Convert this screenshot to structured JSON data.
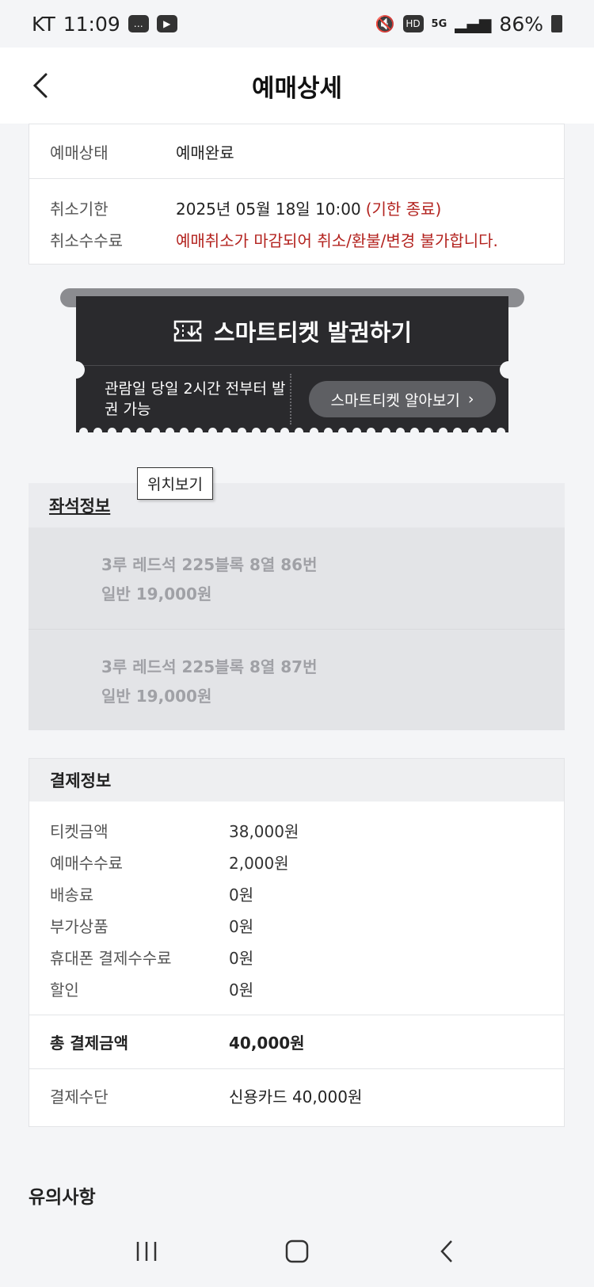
{
  "status_bar": {
    "carrier": "KT",
    "time": "11:09",
    "network": "5G",
    "battery": "86%",
    "left_icons": [
      "chat-icon",
      "youtube-icon"
    ],
    "right_icons": [
      "mute-icon",
      "hd-icon",
      "signal-icon",
      "battery-icon"
    ]
  },
  "header": {
    "title": "예매상세"
  },
  "booking": {
    "status_label": "예매상태",
    "status_value": "예매완료",
    "cancel_deadline_label": "취소기한",
    "cancel_deadline_value": "2025년 05월 18일 10:00",
    "cancel_deadline_note": "(기한 종료)",
    "cancel_fee_label": "취소수수료",
    "cancel_fee_value": "예매취소가 마감되어 취소/환불/변경 불가합니다."
  },
  "smart_ticket": {
    "issue_label": "스마트티켓 발권하기",
    "note": "관람일 당일 2시간 전부터 발권 가능",
    "info_button": "스마트티켓 알아보기"
  },
  "seat_info": {
    "title": "좌석정보",
    "tooltip": "위치보기",
    "seats": [
      {
        "seat": "3루 레드석 225블록 8열 86번",
        "price": "일반 19,000원"
      },
      {
        "seat": "3루 레드석 225블록 8열 87번",
        "price": "일반 19,000원"
      }
    ]
  },
  "payment": {
    "title": "결제정보",
    "rows": [
      {
        "label": "티켓금액",
        "value": "38,000원"
      },
      {
        "label": "예매수수료",
        "value": "2,000원"
      },
      {
        "label": "배송료",
        "value": "0원"
      },
      {
        "label": "부가상품",
        "value": "0원"
      },
      {
        "label": "휴대폰 결제수수료",
        "value": "0원"
      },
      {
        "label": "할인",
        "value": "0원"
      }
    ],
    "total_label": "총 결제금액",
    "total_value": "40,000원",
    "method_label": "결제수단",
    "method_value": "신용카드 40,000원"
  },
  "notice": {
    "title": "유의사항"
  },
  "colors": {
    "accent_red": "#b3231f",
    "ticket_dark": "#2a2a2d",
    "background": "#f4f5f7"
  }
}
